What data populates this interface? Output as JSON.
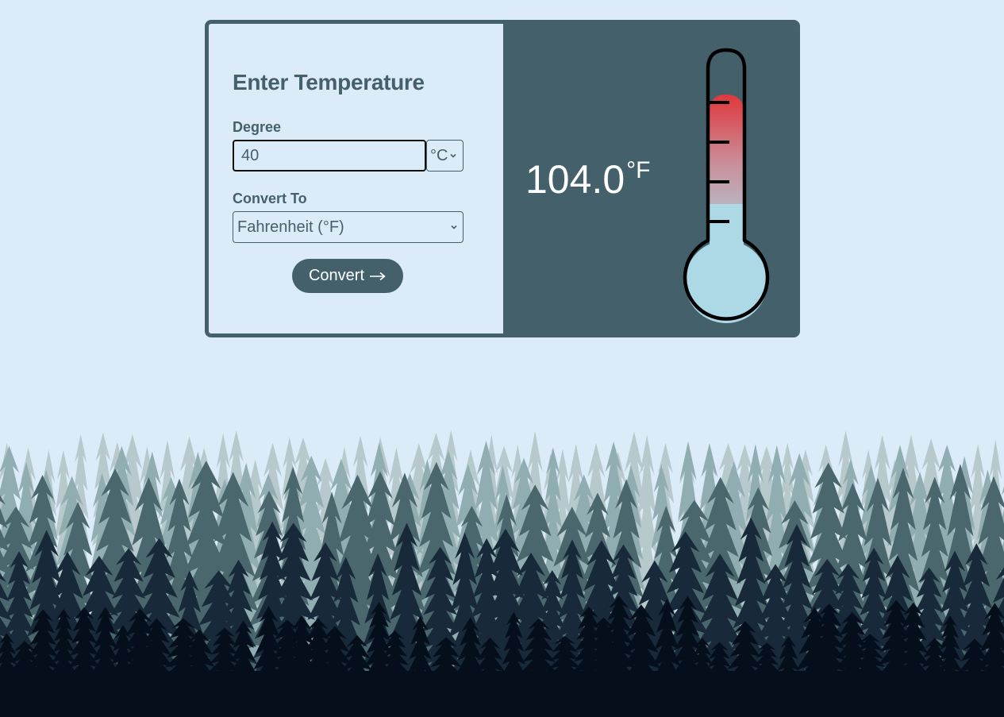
{
  "form": {
    "title": "Enter Temperature",
    "degree_label": "Degree",
    "degree_value": "40",
    "degree_unit": "°C",
    "convert_to_label": "Convert To",
    "convert_to_selected": "Fahrenheit (°F)",
    "convert_button_label": "Convert",
    "convert_button_icon": "arrow-right-icon"
  },
  "result": {
    "value": "104.0",
    "unit": "°F"
  },
  "thermometer": {
    "icon": "thermometer-icon",
    "hot_color": "#e0373c",
    "cold_color": "#add8e6"
  },
  "colors": {
    "background": "#dcebf8",
    "accent": "#44616b",
    "forest_dark": "#050f1c"
  }
}
